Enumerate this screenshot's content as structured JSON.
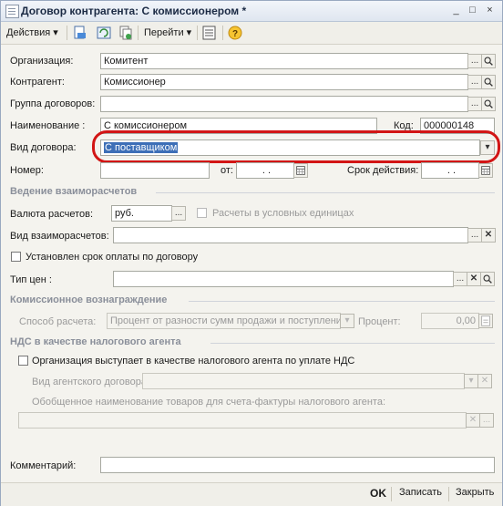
{
  "window": {
    "title": "Договор контрагента: С комиссионером *",
    "controls": [
      "_",
      "□",
      "×"
    ]
  },
  "toolbar": {
    "actions_label": "Действия",
    "goto_label": "Перейти",
    "arrow": "▾",
    "help": "?"
  },
  "form": {
    "org_label": "Организация:",
    "org_value": "Комитент",
    "contractor_label": "Контрагент:",
    "contractor_value": "Комиссионер",
    "group_label": "Группа договоров:",
    "group_value": "",
    "name_label": "Наименование :",
    "name_value": "С комиссионером",
    "code_label": "Код:",
    "code_value": "000000148",
    "type_label": "Вид договора:",
    "type_value": "С поставщиком",
    "number_label": "Номер:",
    "number_value": "",
    "from_label": "от:",
    "from_value": ". .",
    "validity_label": "Срок действия:",
    "validity_value": ". ."
  },
  "settlements": {
    "section": "Ведение взаиморасчетов",
    "currency_label": "Валюта расчетов:",
    "currency_value": "руб.",
    "conditional_units_label": "Расчеты в условных единицах",
    "mode_label": "Вид взаиморасчетов:",
    "mode_value": "",
    "payment_term_label": "Установлен срок оплаты по договору",
    "price_type_label": "Тип цен :",
    "price_type_value": ""
  },
  "commission": {
    "section": "Комиссионное вознаграждение",
    "method_label": "Способ расчета:",
    "method_value": "Процент от разности сумм продажи и поступления",
    "percent_label": "Процент:",
    "percent_value": "0,00"
  },
  "vat": {
    "section": "НДС в качестве налогового агента",
    "agent_label": "Организация выступает в качестве налогового агента по уплате НДС",
    "agent_type_label": "Вид агентского договора:",
    "agent_type_value": "",
    "goods_name_label": "Обобщенное наименование товаров для счета-фактуры налогового агента:",
    "goods_name_value": ""
  },
  "comment": {
    "label": "Комментарий:",
    "value": ""
  },
  "footer": {
    "ok": "OK",
    "save": "Записать",
    "close": "Закрыть"
  },
  "icons": {
    "dots": "...",
    "search": "🔍",
    "clear": "✕",
    "dropdown": "▾",
    "calendar": "calendar-icon"
  }
}
